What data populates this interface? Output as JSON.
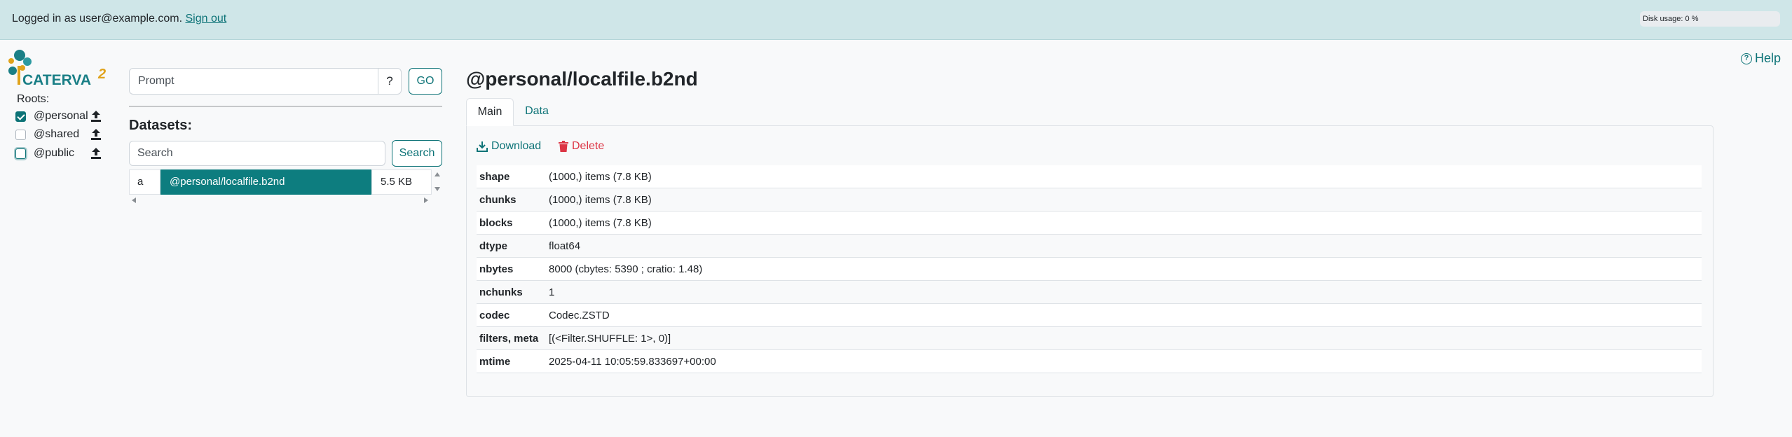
{
  "topbar": {
    "login_prefix": "Logged in as user@example.com.",
    "signout_label": "Sign out",
    "disk_usage": "Disk usage: 0 %"
  },
  "logo": {
    "text": "CATERVA",
    "superscript": "2"
  },
  "roots": {
    "label": "Roots:",
    "items": [
      {
        "name": "@personal",
        "checked": true,
        "icon": "upload-icon"
      },
      {
        "name": "@shared",
        "checked": false,
        "icon": "upload-icon"
      },
      {
        "name": "@public",
        "checked": false,
        "icon": "upload-icon"
      }
    ]
  },
  "prompt": {
    "placeholder": "Prompt",
    "help_label": "?",
    "go_label": "GO"
  },
  "datasets": {
    "title": "Datasets:",
    "search_placeholder": "Search",
    "search_label": "Search",
    "rows": [
      {
        "letter": "a",
        "name": "@personal/localfile.b2nd",
        "size": "5.5 KB"
      }
    ]
  },
  "detail": {
    "title": "@personal/localfile.b2nd",
    "tabs": [
      {
        "label": "Main",
        "active": true
      },
      {
        "label": "Data",
        "active": false
      }
    ],
    "download_label": "Download",
    "delete_label": "Delete",
    "meta": [
      {
        "key": "shape",
        "value": "(1000,) items (7.8 KB)"
      },
      {
        "key": "chunks",
        "value": "(1000,) items (7.8 KB)"
      },
      {
        "key": "blocks",
        "value": "(1000,) items (7.8 KB)"
      },
      {
        "key": "dtype",
        "value": "float64"
      },
      {
        "key": "nbytes",
        "value": "8000 (cbytes: 5390 ; cratio: 1.48)"
      },
      {
        "key": "nchunks",
        "value": "1"
      },
      {
        "key": "codec",
        "value": "Codec.ZSTD"
      },
      {
        "key": "filters, meta",
        "value": "[(<Filter.SHUFFLE: 1>, 0)]"
      },
      {
        "key": "mtime",
        "value": "2025-04-11 10:05:59.833697+00:00"
      }
    ]
  },
  "help": {
    "label": "Help",
    "icon": "question-circle-icon"
  },
  "colors": {
    "accent": "#0d7377",
    "topbar": "#cfe6e8",
    "danger": "#dc3545",
    "selected_row": "#0d7d7f"
  }
}
